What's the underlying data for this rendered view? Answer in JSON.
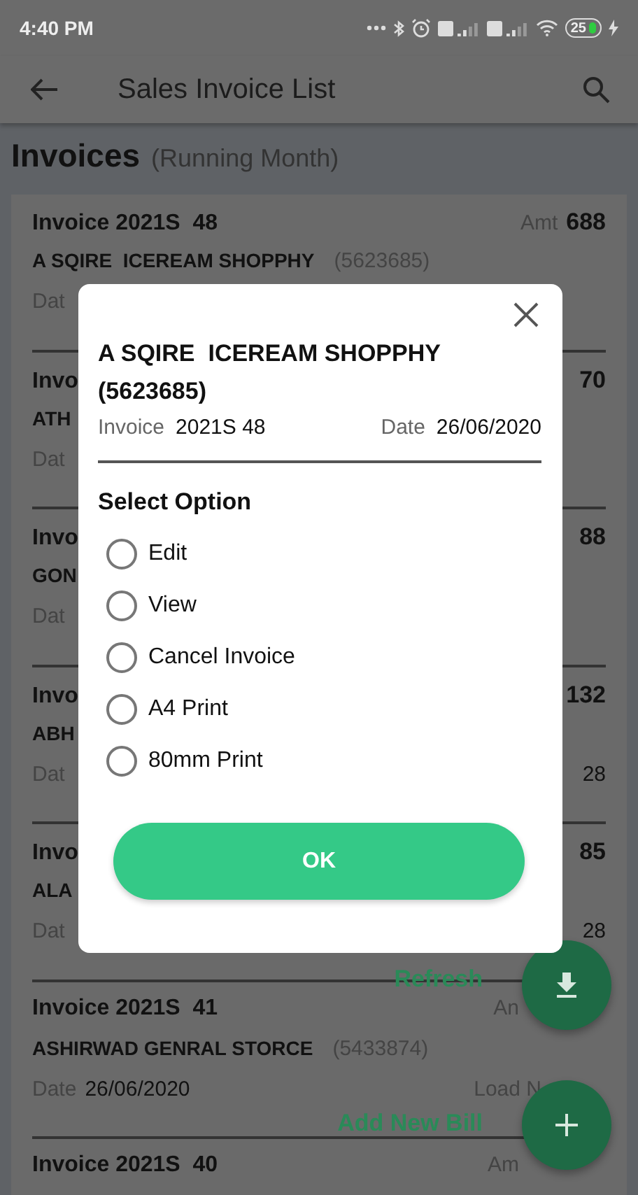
{
  "status_bar": {
    "time": "4:40 PM",
    "battery": "25"
  },
  "app_bar": {
    "title": "Sales Invoice List"
  },
  "header": {
    "title": "Invoices",
    "subtitle": "(Running Month)"
  },
  "invoices": [
    {
      "title": "Invoice 2021S  48",
      "amount_label": "Amt",
      "amount": "688",
      "customer": "A SQIRE  ICEREAM SHOPPHY",
      "code": "(5623685)",
      "date_label": "Dat"
    },
    {
      "title": "Invo",
      "amount": "70",
      "customer": "ATH",
      "date_label": "Dat"
    },
    {
      "title": "Invo",
      "amount": "88",
      "customer": "GON",
      "date_label": "Dat"
    },
    {
      "title": "Invo",
      "amount": "132",
      "customer": "ABH",
      "date_label": "Dat",
      "load": "28"
    },
    {
      "title": "Invo",
      "amount": "85",
      "customer": "ALA",
      "date_label": "Dat",
      "load": "28"
    },
    {
      "title": "Invoice 2021S  41",
      "amount_label": "An",
      "customer": "ASHIRWAD GENRAL STORCE",
      "code": "(5433874)",
      "date_label": "Date",
      "date": "26/06/2020",
      "load_label": "Load N"
    },
    {
      "title": "Invoice 2021S  40",
      "amount_label": "Am"
    }
  ],
  "fabs": [
    {
      "label": "Refresh",
      "kind": "download"
    },
    {
      "label": "Add New Bill",
      "kind": "add"
    }
  ],
  "dialog": {
    "title": "A SQIRE  ICEREAM SHOPPHY",
    "code": "(5623685)",
    "invoice_label": "Invoice",
    "invoice": "2021S 48",
    "date_label": "Date",
    "date": "26/06/2020",
    "section": "Select Option",
    "options": [
      {
        "label": "Edit",
        "selected": false
      },
      {
        "label": "View",
        "selected": false
      },
      {
        "label": "Cancel Invoice",
        "selected": false
      },
      {
        "label": "A4 Print",
        "selected": false
      },
      {
        "label": "80mm Print",
        "selected": false
      }
    ],
    "ok": "OK"
  }
}
